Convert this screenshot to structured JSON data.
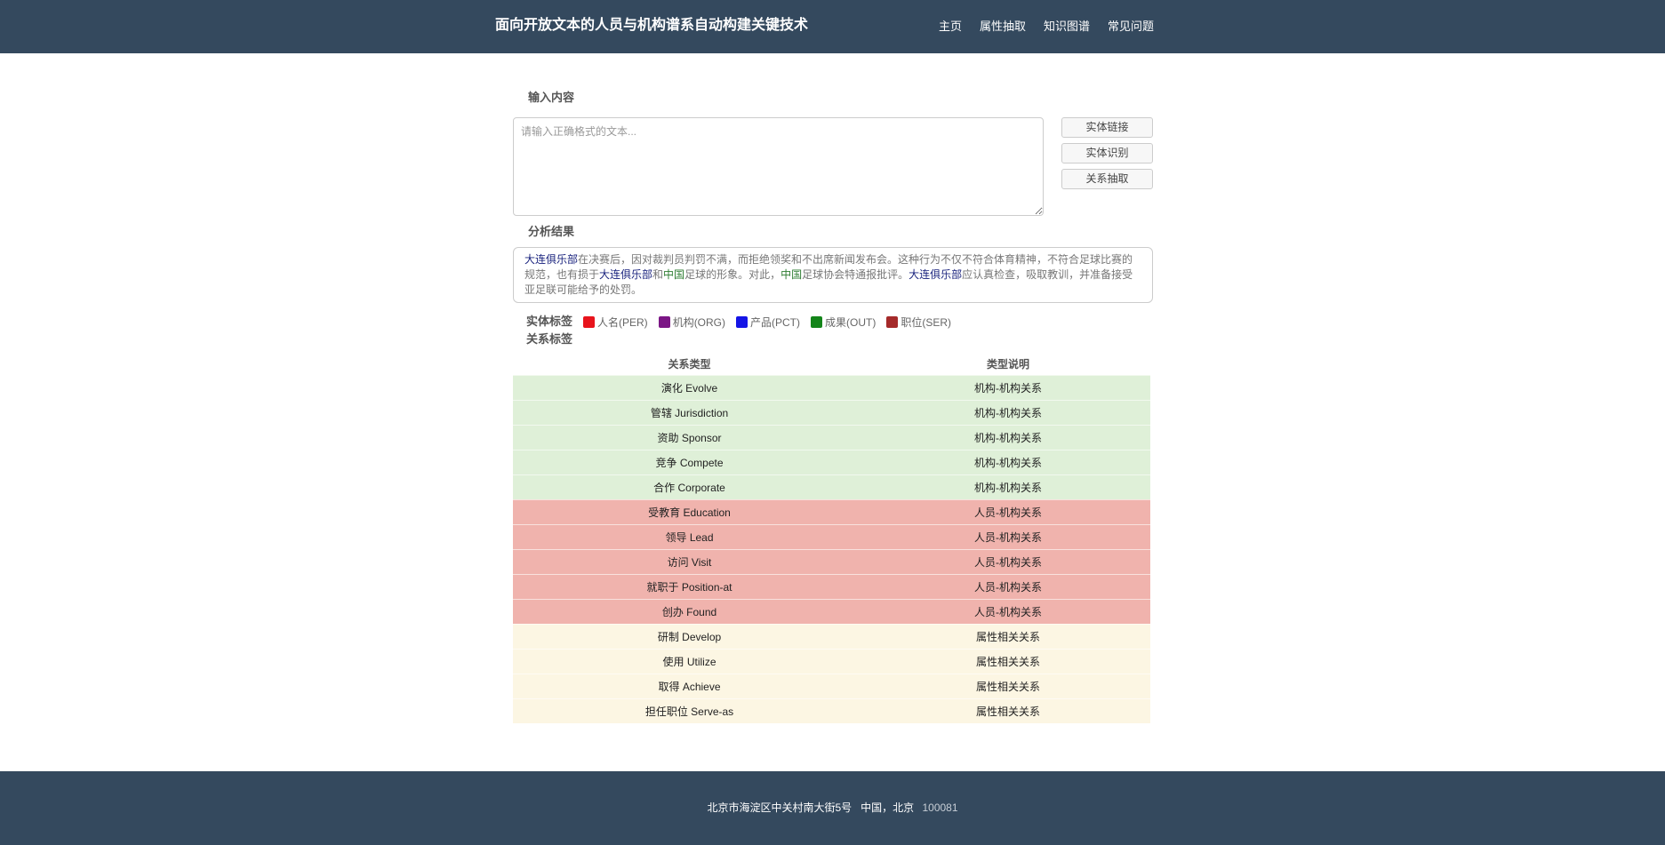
{
  "header": {
    "title": "面向开放文本的人员与机构谱系自动构建关键技术",
    "nav": [
      "主页",
      "属性抽取",
      "知识图谱",
      "常见问题"
    ]
  },
  "input_section": {
    "label": "输入内容",
    "placeholder": "请输入正确格式的文本...",
    "value": "",
    "buttons": [
      "实体链接",
      "实体识别",
      "关系抽取"
    ]
  },
  "result_section": {
    "label": "分析结果",
    "segments": [
      {
        "text": "大连俱乐部",
        "type": "org"
      },
      {
        "text": "在决赛后，因对裁判员判罚不满，而拒绝领奖和不出席新闻发布会。这种行为不仅不符合体育精神，不符合足球比赛的规范，也有损于",
        "type": "plain"
      },
      {
        "text": "大连俱乐部",
        "type": "org"
      },
      {
        "text": "和",
        "type": "plain"
      },
      {
        "text": "中国",
        "type": "loc"
      },
      {
        "text": "足球的形象。对此，",
        "type": "plain"
      },
      {
        "text": "中国",
        "type": "loc"
      },
      {
        "text": "足球协会特通报批评。",
        "type": "plain"
      },
      {
        "text": "大连俱乐部",
        "type": "org"
      },
      {
        "text": "应认真检查，吸取教训，并准备接受亚足联可能给予的处罚。",
        "type": "plain"
      }
    ]
  },
  "entity_labels": {
    "label": "实体标签",
    "items": [
      {
        "name": "人名(PER)",
        "color": "#e8141c"
      },
      {
        "name": "机构(ORG)",
        "color": "#7b1685"
      },
      {
        "name": "产品(PCT)",
        "color": "#1515e6"
      },
      {
        "name": "成果(OUT)",
        "color": "#14851a"
      },
      {
        "name": "职位(SER)",
        "color": "#a52a2a"
      }
    ]
  },
  "relation_labels": {
    "label": "关系标签",
    "headers": [
      "关系类型",
      "类型说明"
    ],
    "rows": [
      {
        "type": "演化 Evolve",
        "desc": "机构-机构关系",
        "group": "org"
      },
      {
        "type": "管辖 Jurisdiction",
        "desc": "机构-机构关系",
        "group": "org"
      },
      {
        "type": "资助 Sponsor",
        "desc": "机构-机构关系",
        "group": "org"
      },
      {
        "type": "竞争 Compete",
        "desc": "机构-机构关系",
        "group": "org"
      },
      {
        "type": "合作 Corporate",
        "desc": "机构-机构关系",
        "group": "org"
      },
      {
        "type": "受教育 Education",
        "desc": "人员-机构关系",
        "group": "per"
      },
      {
        "type": "领导 Lead",
        "desc": "人员-机构关系",
        "group": "per"
      },
      {
        "type": "访问 Visit",
        "desc": "人员-机构关系",
        "group": "per"
      },
      {
        "type": "就职于 Position-at",
        "desc": "人员-机构关系",
        "group": "per"
      },
      {
        "type": "创办 Found",
        "desc": "人员-机构关系",
        "group": "per"
      },
      {
        "type": "研制 Develop",
        "desc": "属性相关关系",
        "group": "attr"
      },
      {
        "type": "使用 Utilize",
        "desc": "属性相关关系",
        "group": "attr"
      },
      {
        "type": "取得 Achieve",
        "desc": "属性相关关系",
        "group": "attr"
      },
      {
        "type": "担任职位 Serve-as",
        "desc": "属性相关关系",
        "group": "attr"
      }
    ]
  },
  "footer": {
    "address": "北京市海淀区中关村南大街5号   中国，北京",
    "zip": "100081"
  }
}
